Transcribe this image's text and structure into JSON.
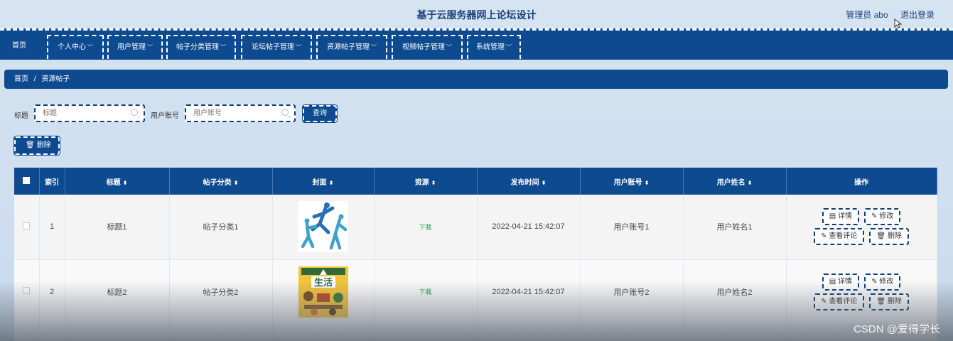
{
  "header": {
    "title": "基于云服务器网上论坛设计",
    "user_label": "管理员 abo",
    "logout_label": "退出登录"
  },
  "nav": {
    "items": [
      {
        "label": "首页",
        "has_caret": false
      },
      {
        "label": "个人中心",
        "has_caret": true
      },
      {
        "label": "用户管理",
        "has_caret": true
      },
      {
        "label": "帖子分类管理",
        "has_caret": true
      },
      {
        "label": "论坛帖子管理",
        "has_caret": true
      },
      {
        "label": "资源帖子管理",
        "has_caret": true
      },
      {
        "label": "视频帖子管理",
        "has_caret": true
      },
      {
        "label": "系统管理",
        "has_caret": true
      }
    ]
  },
  "breadcrumb": {
    "home": "首页",
    "separator": "/",
    "current": "资源帖子"
  },
  "search": {
    "title_label": "标题",
    "title_placeholder": "标题",
    "account_label": "用户账号",
    "account_placeholder": "用户账号",
    "query_label": "查询"
  },
  "toolbar": {
    "delete_label": "删除"
  },
  "table": {
    "headers": {
      "index": "索引",
      "title": "标题",
      "category": "帖子分类",
      "cover": "封面",
      "resource": "资源",
      "published": "发布时间",
      "account": "用户账号",
      "name": "用户姓名",
      "actions": "操作"
    },
    "rows": [
      {
        "index": "1",
        "title": "标题1",
        "category": "帖子分类1",
        "cover_icon": "sports-players-image",
        "resource": "下载",
        "published": "2022-04-21 15:42:07",
        "account": "用户账号1",
        "name": "用户姓名1"
      },
      {
        "index": "2",
        "title": "标题2",
        "category": "帖子分类2",
        "cover_icon": "life-book-cover-image",
        "resource": "下载",
        "published": "2022-04-21 15:42:07",
        "account": "用户账号2",
        "name": "用户姓名2"
      }
    ],
    "actions": {
      "detail": "详情",
      "edit": "修改",
      "comments": "查看评论",
      "delete": "删除"
    }
  },
  "watermark": "CSDN @爱得学长",
  "colors": {
    "primary": "#0d4a8f",
    "background": "#d4e3f1",
    "download": "#2a9d5b"
  }
}
